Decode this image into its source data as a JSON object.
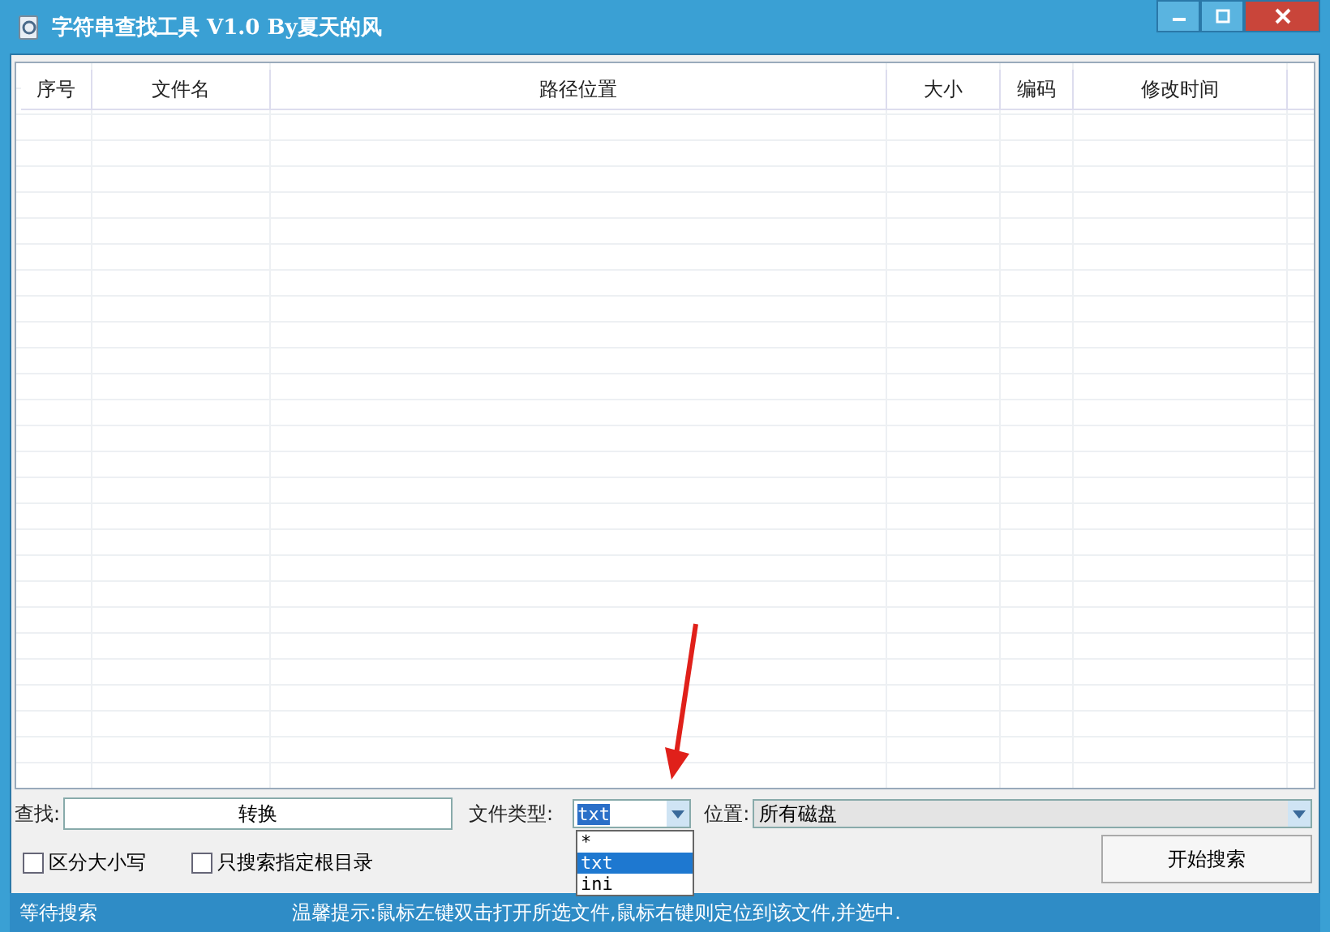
{
  "window": {
    "title": "字符串查找工具 V1.0 By夏天的风"
  },
  "table": {
    "columns": [
      "序号",
      "文件名",
      "路径位置",
      "大小",
      "编码",
      "修改时间"
    ]
  },
  "search": {
    "label": "查找:",
    "value": "转换"
  },
  "file_type": {
    "label": "文件类型:",
    "value": "txt",
    "options": [
      {
        "label": "*",
        "selected": false
      },
      {
        "label": "txt",
        "selected": true
      },
      {
        "label": "ini",
        "selected": false
      }
    ]
  },
  "location": {
    "label": "位置:",
    "value": "所有磁盘"
  },
  "options": [
    {
      "label": "区分大小写",
      "checked": false
    },
    {
      "label": "只搜索指定根目录",
      "checked": false
    }
  ],
  "start_button": "开始搜索",
  "status_bar": {
    "state": "等待搜索",
    "tip": "温馨提示:鼠标左键双击打开所选文件,鼠标右键则定位到该文件,并选中."
  }
}
